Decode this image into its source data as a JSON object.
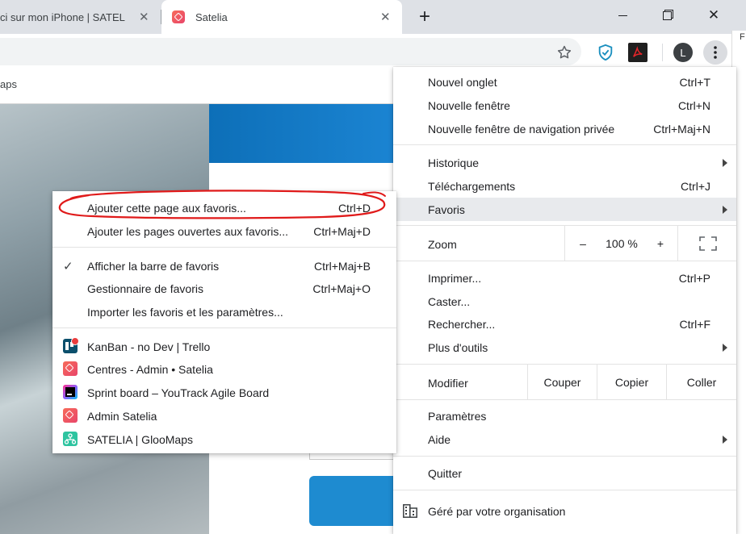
{
  "tabs": [
    {
      "title": "ci sur mon iPhone | SATEL",
      "close": "✕"
    },
    {
      "title": "Satelia",
      "close": "✕"
    }
  ],
  "new_tab": "+",
  "window": {
    "minimize": "—",
    "maximize": "❐",
    "close": "✕"
  },
  "toolbar": {
    "avatar_letter": "L",
    "side_letter": "F"
  },
  "bookmarks_bar": {
    "fragment": "aps"
  },
  "chrome_menu": {
    "new_tab": {
      "label": "Nouvel onglet",
      "shortcut": "Ctrl+T"
    },
    "new_window": {
      "label": "Nouvelle fenêtre",
      "shortcut": "Ctrl+N"
    },
    "incognito": {
      "label": "Nouvelle fenêtre de navigation privée",
      "shortcut": "Ctrl+Maj+N"
    },
    "history": {
      "label": "Historique"
    },
    "downloads": {
      "label": "Téléchargements",
      "shortcut": "Ctrl+J"
    },
    "bookmarks": {
      "label": "Favoris"
    },
    "zoom": {
      "label": "Zoom",
      "minus": "–",
      "value": "100 %",
      "plus": "+"
    },
    "print": {
      "label": "Imprimer...",
      "shortcut": "Ctrl+P"
    },
    "cast": {
      "label": "Caster..."
    },
    "find": {
      "label": "Rechercher...",
      "shortcut": "Ctrl+F"
    },
    "more_tools": {
      "label": "Plus d'outils"
    },
    "edit": {
      "label": "Modifier",
      "cut": "Couper",
      "copy": "Copier",
      "paste": "Coller"
    },
    "settings": {
      "label": "Paramètres"
    },
    "help": {
      "label": "Aide"
    },
    "quit": {
      "label": "Quitter"
    },
    "managed": {
      "label": "Géré par votre organisation"
    }
  },
  "bookmarks_menu": {
    "add_page": {
      "label": "Ajouter cette page aux favoris...",
      "shortcut": "Ctrl+D"
    },
    "add_open_pages": {
      "label": "Ajouter les pages ouvertes aux favoris...",
      "shortcut": "Ctrl+Maj+D"
    },
    "show_bar": {
      "label": "Afficher la barre de favoris",
      "shortcut": "Ctrl+Maj+B",
      "check": "✓"
    },
    "manager": {
      "label": "Gestionnaire de favoris",
      "shortcut": "Ctrl+Maj+O"
    },
    "import": {
      "label": "Importer les favoris et les paramètres..."
    },
    "items": [
      {
        "label": "KanBan - no Dev | Trello",
        "icon": "trello-icon"
      },
      {
        "label": "Centres - Admin • Satelia",
        "icon": "satelia-icon"
      },
      {
        "label": "Sprint board – YouTrack Agile Board",
        "icon": "youtrack-icon"
      },
      {
        "label": "Admin Satelia",
        "icon": "satelia-icon"
      },
      {
        "label": "SATELIA | GlooMaps",
        "icon": "gloomaps-icon"
      }
    ]
  },
  "colors": {
    "annotation": "#e01a1a",
    "highlight": "#e8eaed",
    "satelia": "#f05a5a",
    "gloomaps": "#2ec4a0"
  }
}
